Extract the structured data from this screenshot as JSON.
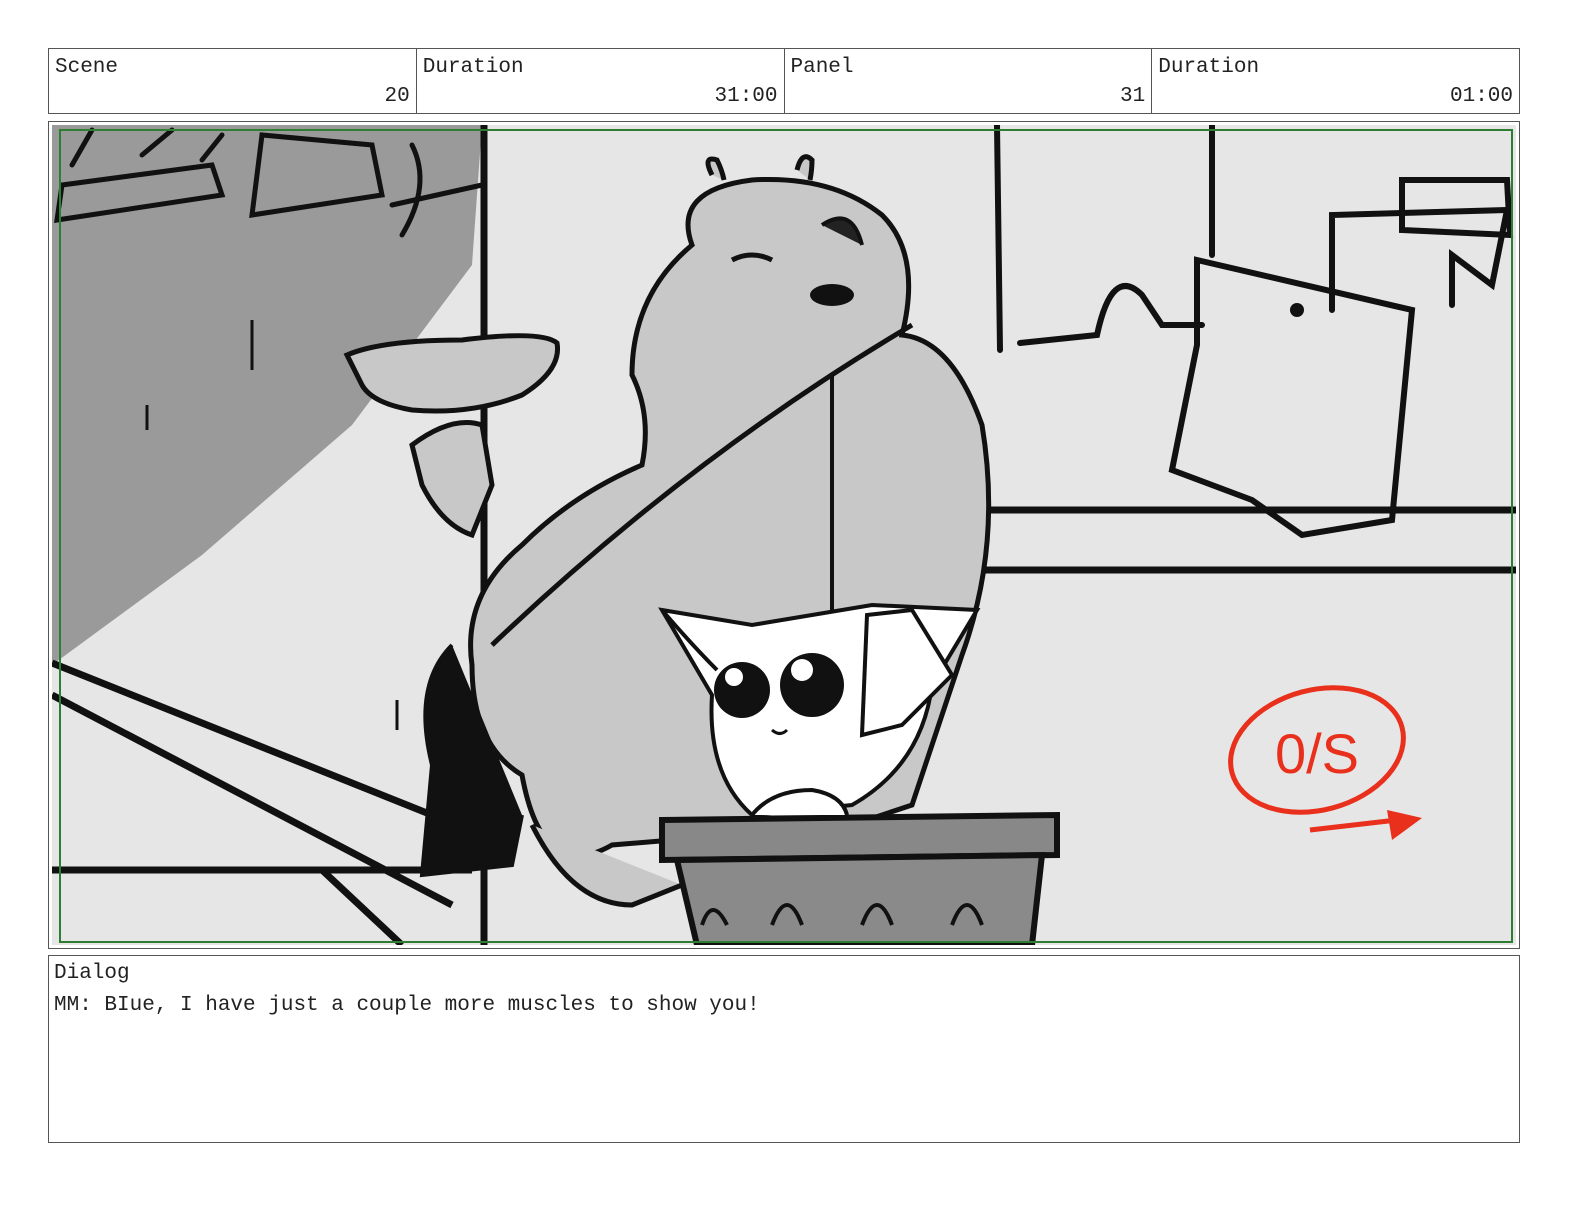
{
  "header": {
    "scene": {
      "label": "Scene",
      "value": "20"
    },
    "scene_duration": {
      "label": "Duration",
      "value": "31:00"
    },
    "panel": {
      "label": "Panel",
      "value": "31"
    },
    "panel_duration": {
      "label": "Duration",
      "value": "01:00"
    }
  },
  "drawing": {
    "annotation": "0/S",
    "colors": {
      "background": "#e6e6e6",
      "shadow": "#9a9a9a",
      "character": "#c8c8c8",
      "ink": "#111111",
      "annotation": "#e8301c",
      "safe_frame": "#2e7d32"
    }
  },
  "dialog": {
    "label": "Dialog",
    "text": "MM: BIue, I have just a couple more muscles to show you!"
  }
}
